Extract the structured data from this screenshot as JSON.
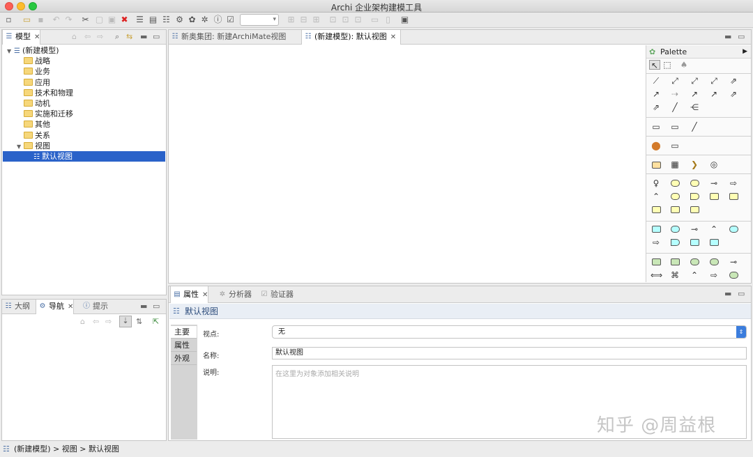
{
  "window": {
    "title": "Archi 企业架构建模工具"
  },
  "model_panel": {
    "tab_label": "模型",
    "tree": [
      {
        "label": "(新建模型)",
        "level": 0,
        "expanded": true,
        "type": "model"
      },
      {
        "label": "战略",
        "level": 1,
        "type": "folder"
      },
      {
        "label": "业务",
        "level": 1,
        "type": "folder"
      },
      {
        "label": "应用",
        "level": 1,
        "type": "folder"
      },
      {
        "label": "技术和物理",
        "level": 1,
        "type": "folder"
      },
      {
        "label": "动机",
        "level": 1,
        "type": "folder"
      },
      {
        "label": "实施和迁移",
        "level": 1,
        "type": "folder"
      },
      {
        "label": "其他",
        "level": 1,
        "type": "folder"
      },
      {
        "label": "关系",
        "level": 1,
        "type": "folder"
      },
      {
        "label": "视图",
        "level": 1,
        "expanded": true,
        "type": "folder"
      },
      {
        "label": "默认视图",
        "level": 2,
        "type": "view",
        "selected": true
      }
    ]
  },
  "nav_panel": {
    "tabs": [
      "大纲",
      "导航",
      "提示"
    ],
    "active": "导航"
  },
  "editor": {
    "tabs": [
      {
        "label": "新奥集团: 新建ArchiMate视图",
        "active": false
      },
      {
        "label": "(新建模型): 默认视图",
        "active": true
      }
    ]
  },
  "palette": {
    "title": "Palette"
  },
  "properties": {
    "tabs": [
      "属性",
      "分析器",
      "验证器"
    ],
    "header": "默认视图",
    "side_tabs": [
      "主要",
      "属性",
      "外观"
    ],
    "viewpoint_label": "视点:",
    "viewpoint_value": "无",
    "name_label": "名称:",
    "name_value": "默认视图",
    "doc_label": "说明:",
    "doc_placeholder": "在这里为对象添加相关说明"
  },
  "status": {
    "breadcrumb": "(新建模型) > 视图 > 默认视图"
  },
  "watermark": "知乎 @周益根"
}
